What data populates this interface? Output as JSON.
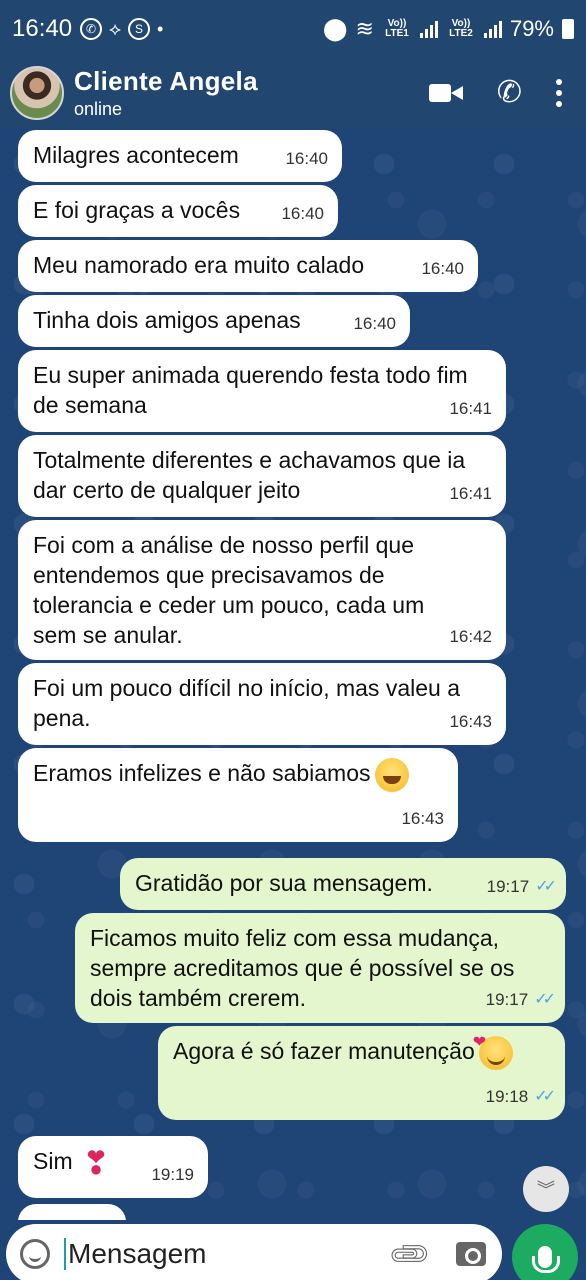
{
  "status_bar": {
    "time": "16:40",
    "battery": "79%",
    "sim1": "Vo)) LTE1",
    "sim2": "Vo)) LTE2"
  },
  "header": {
    "contact_name": "Cliente Angela",
    "contact_status": "online"
  },
  "messages": [
    {
      "dir": "in",
      "text": "Milagres acontecem",
      "time": "16:40"
    },
    {
      "dir": "in",
      "text": "E foi graças a vocês",
      "time": "16:40"
    },
    {
      "dir": "in",
      "text": "Meu namorado era muito calado",
      "time": "16:40"
    },
    {
      "dir": "in",
      "text": "Tinha dois amigos apenas",
      "time": "16:40"
    },
    {
      "dir": "in",
      "text": "Eu super animada querendo festa todo fim de semana",
      "time": "16:41"
    },
    {
      "dir": "in",
      "text": "Totalmente diferentes e achavamos que ia dar certo de qualquer jeito",
      "time": "16:41"
    },
    {
      "dir": "in",
      "text": "Foi com a análise de nosso perfil que entendemos que precisavamos de tolerancia e ceder um pouco, cada um sem se anular.",
      "time": "16:42"
    },
    {
      "dir": "in",
      "text": "Foi um pouco difícil no início, mas valeu a pena.",
      "time": "16:43"
    },
    {
      "dir": "in",
      "text": "Eramos infelizes e não sabiamos",
      "time": "16:43",
      "emoji": "grinning-sweat"
    },
    {
      "dir": "out",
      "text": "Gratidão por sua mensagem.",
      "time": "19:17",
      "read": true
    },
    {
      "dir": "out",
      "text": "Ficamos muito feliz com essa mudança, sempre acreditamos que é possível se os dois também crerem.",
      "time": "19:17",
      "read": true
    },
    {
      "dir": "out",
      "text": "Agora é só fazer manutenção",
      "time": "19:18",
      "read": true,
      "emoji": "smiling-hearts"
    },
    {
      "dir": "in",
      "text": "Sim",
      "time": "19:19",
      "emoji": "heart-exclamation"
    }
  ],
  "input": {
    "placeholder": "Mensagem"
  },
  "colors": {
    "header_bg": "#21466f",
    "chat_bg": "#1f4476",
    "incoming_bubble": "#ffffff",
    "outgoing_bubble": "#e3f6cd",
    "read_ticks": "#4fa3e8",
    "mic_button": "#1daa61"
  }
}
